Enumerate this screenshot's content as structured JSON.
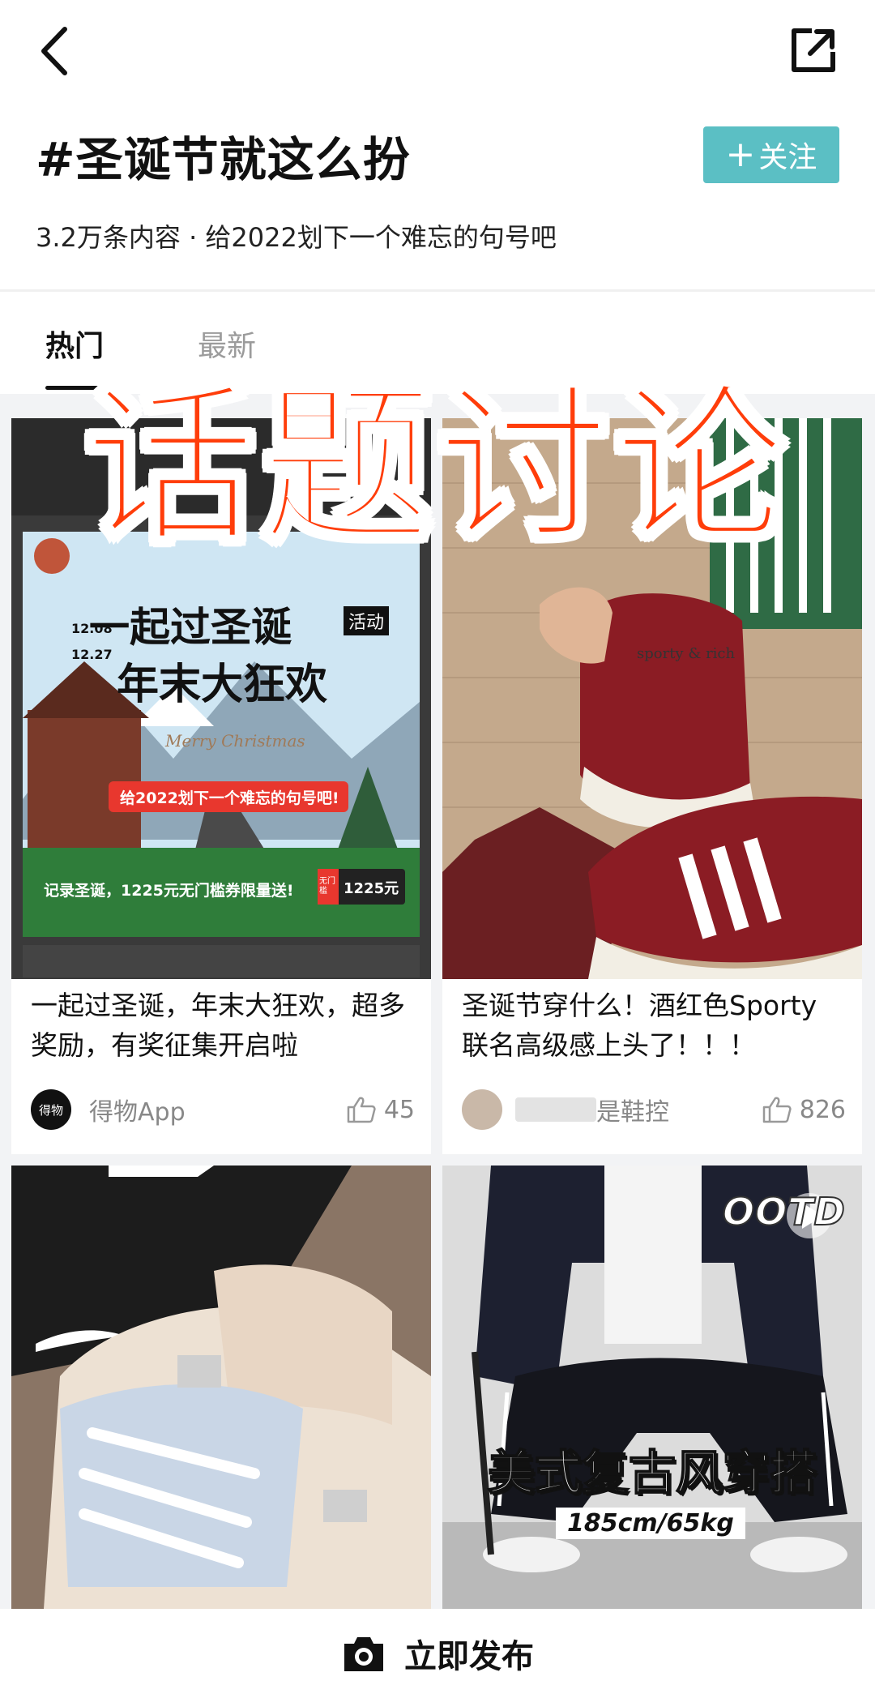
{
  "header": {
    "title": "#圣诞节就这么扮",
    "follow_label": "关注",
    "subtitle": "3.2万条内容 · 给2022划下一个难忘的句号吧"
  },
  "tabs": [
    {
      "label": "热门",
      "active": true
    },
    {
      "label": "最新",
      "active": false
    }
  ],
  "overlay": {
    "text": "话题讨论",
    "color": "#ff3d0a"
  },
  "cards": [
    {
      "title": "一起过圣诞，年末大狂欢，超多奖励，有奖征集开启啦",
      "author": "得物App",
      "avatar_text": "得物",
      "likes": "45",
      "poster": {
        "headline_1": "一起过圣诞",
        "headline_2": "年末大狂欢",
        "badge": "活动",
        "date_1": "12.08",
        "date_2": "12.27",
        "script_text": "Merry Christmas",
        "ribbon": "给2022划下一个难忘的句号吧!",
        "footer": "记录圣诞，1225元无门槛券限量送!",
        "coupon_label": "无门槛",
        "coupon_value": "1225元"
      }
    },
    {
      "title": "圣诞节穿什么！酒红色Sporty联名高级感上头了！！！",
      "author": "是鞋控",
      "likes": "826",
      "shoe_text": "sporty & rich"
    },
    {
      "overlay_text": ""
    },
    {
      "badge": "OOTD",
      "headline": "美式复古风穿搭",
      "stats": "185cm/65kg"
    }
  ],
  "bottom": {
    "publish_label": "立即发布"
  },
  "colors": {
    "accent": "#5bbfc4",
    "overlay_red": "#ff3d0a"
  }
}
